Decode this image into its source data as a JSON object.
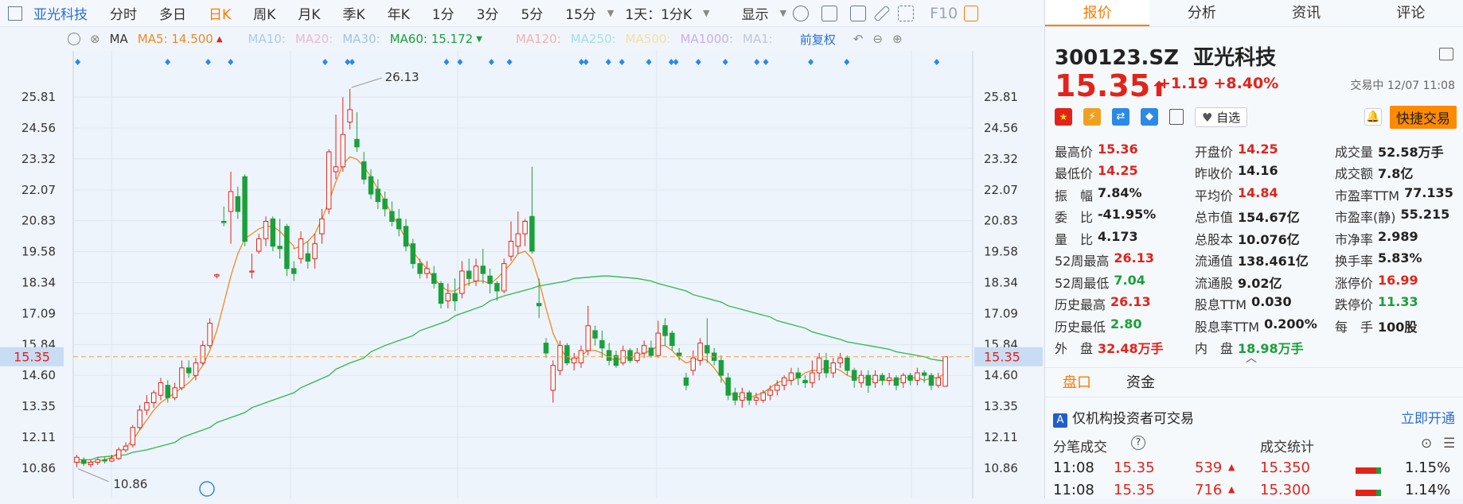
{
  "header": {
    "name": "亚光科技",
    "tabs": [
      "分时",
      "多日",
      "日K",
      "周K",
      "月K",
      "季K",
      "年K",
      "1分",
      "3分",
      "5分",
      "15分"
    ],
    "active_tab": "日K",
    "period_select": "1天：1分K",
    "display": "显示",
    "f10": "F10"
  },
  "ma_bar": {
    "ma": "MA",
    "ma5": "MA5: 14.500",
    "ma10": "MA10:",
    "ma20": "MA20:",
    "ma30": "MA30:",
    "ma60": "MA60: 15.172",
    "ma120": "MA120:",
    "ma250": "MA250:",
    "ma500": "MA500:",
    "ma1000": "MA1000:",
    "ma1": "MA1:",
    "adjust": "前复权"
  },
  "colors": {
    "up": "#e2231a",
    "down": "#1aa03a",
    "accent": "#ff7a00",
    "link": "#2a6fd6"
  },
  "chart_data": {
    "type": "candlestick",
    "y_ticks": [
      "25.81",
      "24.56",
      "23.32",
      "22.07",
      "20.83",
      "19.58",
      "18.34",
      "17.09",
      "15.84",
      "14.60",
      "13.35",
      "12.11",
      "10.86"
    ],
    "current_price_label": "15.35",
    "high_annotation": "26.13",
    "low_annotation": "10.86",
    "candles": [
      [
        11.1,
        11.3,
        10.9,
        11.4
      ],
      [
        11.2,
        11.05,
        10.95,
        11.3
      ],
      [
        11.0,
        11.1,
        10.9,
        11.2
      ],
      [
        11.1,
        11.2,
        11.0,
        11.3
      ],
      [
        11.2,
        11.15,
        11.05,
        11.3
      ],
      [
        11.15,
        11.25,
        11.1,
        11.4
      ],
      [
        11.25,
        11.6,
        11.2,
        11.7
      ],
      [
        11.6,
        11.75,
        11.5,
        11.9
      ],
      [
        11.8,
        12.5,
        11.7,
        12.6
      ],
      [
        12.5,
        13.2,
        12.4,
        13.4
      ],
      [
        13.2,
        13.5,
        13.0,
        13.8
      ],
      [
        13.5,
        13.9,
        13.3,
        14.0
      ],
      [
        13.8,
        14.3,
        13.6,
        14.5
      ],
      [
        14.2,
        13.7,
        13.5,
        14.4
      ],
      [
        13.7,
        14.1,
        13.6,
        14.3
      ],
      [
        14.1,
        14.9,
        14.0,
        15.2
      ],
      [
        14.9,
        14.7,
        14.5,
        15.2
      ],
      [
        14.6,
        15.1,
        14.4,
        15.3
      ],
      [
        15.1,
        15.8,
        15.0,
        16.0
      ],
      [
        15.8,
        16.7,
        15.7,
        16.9
      ],
      [
        18.6,
        18.65,
        18.5,
        18.7
      ],
      [
        20.8,
        20.75,
        20.6,
        21.4
      ],
      [
        21.2,
        22.0,
        19.9,
        22.8
      ],
      [
        21.8,
        21.2,
        20.9,
        22.2
      ],
      [
        22.6,
        20.0,
        19.8,
        22.7
      ],
      [
        18.8,
        18.8,
        18.5,
        19.5
      ],
      [
        19.6,
        20.1,
        19.5,
        20.3
      ],
      [
        20.1,
        20.8,
        19.8,
        21.0
      ],
      [
        20.9,
        19.8,
        19.6,
        21.0
      ],
      [
        19.8,
        19.7,
        19.3,
        20.9
      ],
      [
        20.6,
        18.9,
        18.6,
        20.7
      ],
      [
        18.9,
        18.7,
        18.4,
        19.2
      ],
      [
        19.3,
        20.1,
        19.1,
        20.4
      ],
      [
        19.5,
        19.2,
        18.9,
        20.0
      ],
      [
        19.3,
        19.9,
        18.9,
        20.3
      ],
      [
        20.3,
        20.9,
        19.9,
        21.3
      ],
      [
        21.3,
        23.6,
        21.1,
        23.7
      ],
      [
        22.8,
        23.0,
        22.5,
        25.1
      ],
      [
        23.0,
        24.3,
        22.8,
        25.8
      ],
      [
        24.8,
        25.3,
        24.5,
        26.13
      ],
      [
        24.1,
        23.8,
        23.6,
        25.2
      ],
      [
        23.2,
        22.5,
        22.3,
        23.6
      ],
      [
        22.6,
        21.9,
        21.7,
        22.9
      ],
      [
        22.1,
        21.6,
        21.3,
        22.5
      ],
      [
        21.7,
        21.3,
        21.0,
        22.0
      ],
      [
        21.2,
        20.8,
        20.6,
        21.6
      ],
      [
        20.9,
        20.5,
        20.2,
        21.3
      ],
      [
        20.6,
        19.8,
        19.6,
        20.9
      ],
      [
        19.9,
        19.1,
        18.9,
        20.1
      ],
      [
        19.1,
        18.7,
        18.5,
        19.3
      ],
      [
        18.7,
        18.9,
        18.5,
        19.2
      ],
      [
        18.7,
        18.3,
        18.1,
        19.0
      ],
      [
        18.3,
        17.5,
        17.3,
        18.4
      ],
      [
        17.6,
        17.9,
        17.3,
        18.3
      ],
      [
        17.9,
        17.6,
        17.2,
        18.5
      ],
      [
        17.9,
        18.8,
        17.7,
        19.2
      ],
      [
        18.8,
        18.5,
        18.2,
        19.3
      ],
      [
        18.4,
        19.0,
        18.2,
        19.3
      ],
      [
        19.0,
        18.7,
        18.3,
        19.7
      ],
      [
        18.6,
        18.3,
        17.9,
        18.9
      ],
      [
        18.3,
        18.0,
        17.6,
        18.4
      ],
      [
        18.0,
        19.1,
        17.9,
        19.3
      ],
      [
        19.4,
        20.0,
        19.2,
        20.8
      ],
      [
        19.8,
        20.3,
        19.5,
        21.2
      ],
      [
        20.3,
        20.8,
        19.8,
        20.9
      ],
      [
        21.0,
        19.6,
        19.5,
        23.0
      ],
      [
        17.5,
        17.4,
        16.9,
        18.5
      ],
      [
        15.9,
        15.5,
        15.3,
        16.1
      ],
      [
        14.0,
        15.0,
        13.5,
        15.2
      ],
      [
        14.8,
        15.8,
        14.6,
        16.0
      ],
      [
        15.8,
        15.1,
        15.0,
        15.9
      ],
      [
        15.1,
        15.3,
        14.8,
        15.5
      ],
      [
        15.1,
        15.6,
        14.9,
        15.8
      ],
      [
        15.6,
        16.6,
        15.4,
        17.4
      ],
      [
        16.4,
        16.1,
        15.8,
        16.6
      ],
      [
        16.0,
        15.7,
        15.3,
        16.4
      ],
      [
        15.6,
        15.2,
        15.0,
        15.9
      ],
      [
        15.4,
        15.0,
        14.9,
        15.6
      ],
      [
        15.1,
        15.6,
        15.0,
        15.8
      ],
      [
        15.6,
        15.2,
        15.1,
        15.7
      ],
      [
        15.2,
        15.5,
        15.1,
        15.7
      ],
      [
        15.5,
        15.8,
        15.3,
        16.0
      ],
      [
        15.7,
        15.4,
        15.3,
        16.0
      ],
      [
        15.4,
        16.3,
        15.3,
        16.8
      ],
      [
        16.6,
        16.2,
        15.8,
        16.9
      ],
      [
        16.3,
        15.8,
        15.6,
        16.4
      ],
      [
        15.5,
        15.4,
        15.2,
        15.7
      ],
      [
        14.5,
        14.2,
        14.0,
        14.7
      ],
      [
        14.8,
        15.3,
        14.6,
        15.6
      ],
      [
        15.2,
        15.9,
        15.0,
        16.1
      ],
      [
        15.8,
        15.5,
        15.1,
        16.9
      ],
      [
        15.5,
        15.2,
        15.0,
        15.7
      ],
      [
        15.2,
        14.6,
        14.3,
        15.4
      ],
      [
        14.5,
        13.8,
        13.6,
        14.7
      ],
      [
        13.9,
        13.6,
        13.4,
        14.1
      ],
      [
        13.6,
        13.9,
        13.3,
        14.1
      ],
      [
        13.9,
        13.6,
        13.4,
        14.0
      ],
      [
        13.6,
        13.7,
        13.4,
        13.9
      ],
      [
        13.6,
        13.9,
        13.5,
        14.0
      ],
      [
        13.8,
        14.0,
        13.6,
        14.2
      ],
      [
        14.0,
        14.2,
        13.8,
        14.4
      ],
      [
        14.2,
        14.5,
        14.0,
        14.6
      ],
      [
        14.4,
        14.7,
        14.2,
        14.9
      ],
      [
        14.7,
        14.5,
        14.2,
        14.9
      ],
      [
        14.4,
        14.3,
        14.1,
        14.6
      ],
      [
        14.3,
        14.7,
        14.1,
        15.2
      ],
      [
        14.7,
        15.3,
        14.4,
        15.5
      ],
      [
        15.2,
        14.7,
        14.5,
        15.5
      ],
      [
        14.7,
        15.1,
        14.5,
        15.3
      ],
      [
        15.1,
        15.3,
        14.9,
        15.5
      ],
      [
        15.3,
        14.8,
        14.6,
        15.4
      ],
      [
        14.8,
        14.4,
        14.1,
        14.9
      ],
      [
        14.3,
        14.6,
        14.1,
        14.8
      ],
      [
        14.6,
        14.2,
        13.9,
        14.8
      ],
      [
        14.3,
        14.6,
        14.1,
        14.8
      ],
      [
        14.6,
        14.4,
        14.2,
        14.7
      ],
      [
        14.4,
        14.5,
        14.2,
        14.7
      ],
      [
        14.5,
        14.2,
        14.0,
        14.6
      ],
      [
        14.3,
        14.6,
        14.1,
        14.7
      ],
      [
        14.6,
        14.4,
        14.2,
        14.7
      ],
      [
        14.4,
        14.7,
        14.2,
        14.9
      ],
      [
        14.7,
        14.6,
        14.3,
        14.8
      ],
      [
        14.6,
        14.2,
        14.0,
        14.7
      ],
      [
        14.2,
        14.5,
        14.1,
        14.7
      ],
      [
        14.16,
        15.35,
        14.25,
        15.36
      ]
    ],
    "ma_orange": [
      11.1,
      11.1,
      11.1,
      11.15,
      11.2,
      11.3,
      11.5,
      11.7,
      12.0,
      12.4,
      12.8,
      13.2,
      13.5,
      13.7,
      13.9,
      14.1,
      14.3,
      14.6,
      15.0,
      15.6,
      16.4,
      17.5,
      18.6,
      19.5,
      20.1,
      20.3,
      20.5,
      20.6,
      20.6,
      20.4,
      20.1,
      19.8,
      19.7,
      19.8,
      20.0,
      20.3,
      20.9,
      21.6,
      22.4,
      23.1,
      23.4,
      23.3,
      23.0,
      22.6,
      22.1,
      21.6,
      21.1,
      20.6,
      20.1,
      19.6,
      19.2,
      18.9,
      18.5,
      18.2,
      18.0,
      18.0,
      18.2,
      18.3,
      18.4,
      18.4,
      18.3,
      18.5,
      18.8,
      19.1,
      19.5,
      19.6,
      19.3,
      18.4,
      17.3,
      16.3,
      15.7,
      15.3,
      15.2,
      15.4,
      15.6,
      15.6,
      15.5,
      15.3,
      15.2,
      15.3,
      15.3,
      15.4,
      15.5,
      15.6,
      15.8,
      15.8,
      15.6,
      15.3,
      15.1,
      15.2,
      15.3,
      15.2,
      14.9,
      14.5,
      14.1,
      13.9,
      13.8,
      13.7,
      13.7,
      13.8,
      13.9,
      14.1,
      14.3,
      14.4,
      14.4,
      14.5,
      14.7,
      14.8,
      14.8,
      14.9,
      14.9,
      14.8,
      14.6,
      14.5,
      14.5,
      14.5,
      14.4,
      14.4,
      14.4,
      14.4,
      14.5,
      14.5,
      14.5,
      14.4,
      14.5,
      14.5,
      14.7
    ],
    "ma_green": [
      11.2,
      11.2,
      11.3,
      11.35,
      11.4,
      11.5,
      11.6,
      11.75,
      11.9,
      12.1,
      12.3,
      12.5,
      12.7,
      12.9,
      13.1,
      13.3,
      13.5,
      13.7,
      13.9,
      14.1,
      14.35,
      14.6,
      14.85,
      15.1,
      15.3,
      15.55,
      15.8,
      16.0,
      16.2,
      16.4,
      16.6,
      16.8,
      17.0,
      17.2,
      17.4,
      17.6,
      17.8,
      17.95,
      18.1,
      18.2,
      18.3,
      18.4,
      18.5,
      18.55,
      18.6,
      18.6,
      18.55,
      18.5,
      18.4,
      18.3,
      18.15,
      18.0,
      17.85,
      17.7,
      17.55,
      17.4,
      17.25,
      17.1,
      16.95,
      16.8,
      16.65,
      16.5,
      16.35,
      16.2,
      16.05,
      15.95,
      15.85,
      15.75,
      15.65,
      15.55,
      15.45,
      15.35,
      15.25,
      15.172
    ],
    "marker_fractions": [
      0.005,
      0.105,
      0.15,
      0.175,
      0.28,
      0.305,
      0.31,
      0.415,
      0.43,
      0.465,
      0.485,
      0.565,
      0.57,
      0.595,
      0.61,
      0.64,
      0.665,
      0.67,
      0.695,
      0.725,
      0.76,
      0.77,
      0.82,
      0.86,
      0.96
    ]
  },
  "quote": {
    "code": "300123.SZ",
    "name": "亚光科技",
    "price": "15.35",
    "change": "+1.19",
    "pct": "+8.40%",
    "status": "交易中 12/07 11:08",
    "follow": "自选",
    "quick_trade": "快捷交易",
    "rows": [
      [
        [
          "最高价",
          "15.36",
          "red"
        ],
        [
          "开盘价",
          "14.25",
          "red"
        ],
        [
          "成交量",
          "52.58万手",
          "dark"
        ]
      ],
      [
        [
          "最低价",
          "14.25",
          "red"
        ],
        [
          "昨收价",
          "14.16",
          "dark"
        ],
        [
          "成交额",
          "7.8亿",
          "dark"
        ]
      ],
      [
        [
          "振　幅",
          "7.84%",
          "dark"
        ],
        [
          "平均价",
          "14.84",
          "red"
        ],
        [
          "市盈率TTM",
          "77.135",
          "dark"
        ]
      ],
      [
        [
          "委　比",
          "-41.95%",
          "dark"
        ],
        [
          "总市值",
          "154.67亿",
          "dark"
        ],
        [
          "市盈率(静)",
          "55.215",
          "dark"
        ]
      ],
      [
        [
          "量　比",
          "4.173",
          "dark"
        ],
        [
          "总股本",
          "10.076亿",
          "dark"
        ],
        [
          "市净率",
          "2.989",
          "dark"
        ]
      ],
      [
        [
          "52周最高",
          "26.13",
          "red"
        ],
        [
          "流通值",
          "138.461亿",
          "dark"
        ],
        [
          "换手率",
          "5.83%",
          "dark"
        ]
      ],
      [
        [
          "52周最低",
          "7.04",
          "green"
        ],
        [
          "流通股",
          "9.02亿",
          "dark"
        ],
        [
          "涨停价",
          "16.99",
          "red"
        ]
      ],
      [
        [
          "历史最高",
          "26.13",
          "red"
        ],
        [
          "股息TTM",
          "0.030",
          "dark"
        ],
        [
          "跌停价",
          "11.33",
          "green"
        ]
      ],
      [
        [
          "历史最低",
          "2.80",
          "green"
        ],
        [
          "股息率TTM",
          "0.200%",
          "dark"
        ],
        [
          "每　手",
          "100股",
          "dark"
        ]
      ],
      [
        [
          "外　盘",
          "32.48万手",
          "red"
        ],
        [
          "内　盘",
          "18.98万手",
          "green"
        ]
      ]
    ]
  },
  "right_tabs": [
    "报价",
    "分析",
    "资讯",
    "评论"
  ],
  "lower": {
    "tab1": "盘口",
    "tab2": "资金",
    "notice": "仅机构投资者可交易",
    "open_link": "立即开通",
    "ticks_title": "分笔成交",
    "stats_title": "成交统计",
    "ticks": [
      [
        "11:08",
        "15.35",
        "539"
      ],
      [
        "11:08",
        "15.35",
        "716"
      ]
    ],
    "stats": [
      [
        "15.350",
        "1.15%"
      ],
      [
        "15.300",
        "1.14%"
      ]
    ]
  }
}
